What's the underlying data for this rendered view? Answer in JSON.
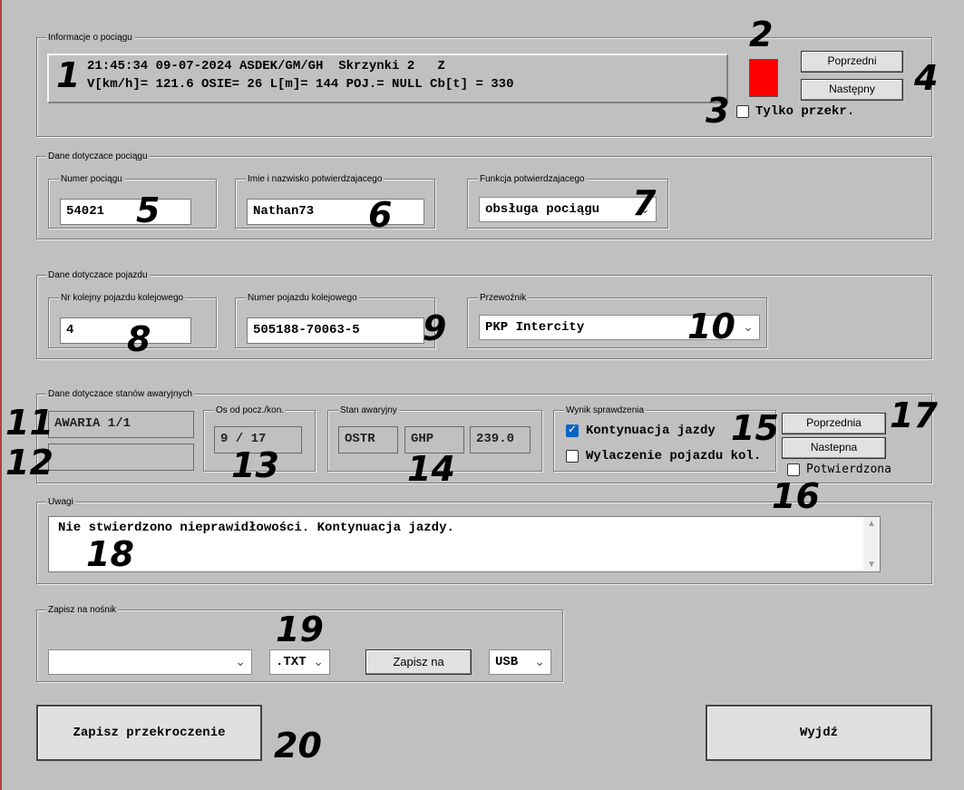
{
  "train_info": {
    "legend": "Informacje o pociągu",
    "line1": "21:45:34 09-07-2024 ASDEK/GM/GH  Skrzynki 2   Z",
    "line2": "V[km/h]= 121.6 OSIE= 26 L[m]= 144 POJ.= NULL Cb[t] = 330",
    "indicator_color": "#ff0000",
    "prev_button": "Poprzedni",
    "next_button": "Następny",
    "only_exceed_label": "Tylko przekr.",
    "only_exceed_checked": false
  },
  "train_data": {
    "legend": "Dane dotyczace pociągu",
    "number_legend": "Numer pociągu",
    "number_value": "54021",
    "name_legend": "Imie i nazwisko potwierdzajacego",
    "name_value": "Nathan73",
    "function_legend": "Funkcja potwierdzajacego",
    "function_value": "obsługa pociągu"
  },
  "vehicle_data": {
    "legend": "Dane dotyczace pojazdu",
    "seq_legend": "Nr kolejny pojazdu kolejowego",
    "seq_value": "4",
    "vehicle_legend": "Numer pojazdu kolejowego",
    "vehicle_value": "505188-70063-5",
    "carrier_legend": "Przewoźnik",
    "carrier_value": "PKP Intercity"
  },
  "emergency": {
    "legend": "Dane dotyczace stanów awaryjnych",
    "alarm_value": "AWARIA 1/1",
    "alarm_value_2": "",
    "axis_legend": "Os od pocz./kon.",
    "axis_value": "9 / 17",
    "state_legend": "Stan awaryjny",
    "state_a": "OSTR",
    "state_b": "GHP",
    "state_c": "239.0",
    "result_legend": "Wynik sprawdzenia",
    "continue_label": "Kontynuacja jazdy",
    "continue_checked": true,
    "disable_label": "Wylaczenie pojazdu kol.",
    "disable_checked": false,
    "prev_button": "Poprzednia",
    "next_button": "Nastepna",
    "confirmed_label": "Potwierdzona",
    "confirmed_checked": false
  },
  "notes": {
    "legend": "Uwagi",
    "text": "Nie stwierdzono nieprawidłowości. Kontynuacja jazdy."
  },
  "save_media": {
    "legend": "Zapisz na nośnik",
    "path_value": "",
    "format_value": ".TXT",
    "save_button": "Zapisz na",
    "target_value": "USB"
  },
  "footer": {
    "save_exceed_button": "Zapisz przekroczenie",
    "exit_button": "Wyjdź"
  },
  "markers": [
    "1",
    "2",
    "3",
    "4",
    "5",
    "6",
    "7",
    "8",
    "9",
    "10",
    "11",
    "12",
    "13",
    "14",
    "15",
    "16",
    "17",
    "18",
    "19",
    "20"
  ]
}
